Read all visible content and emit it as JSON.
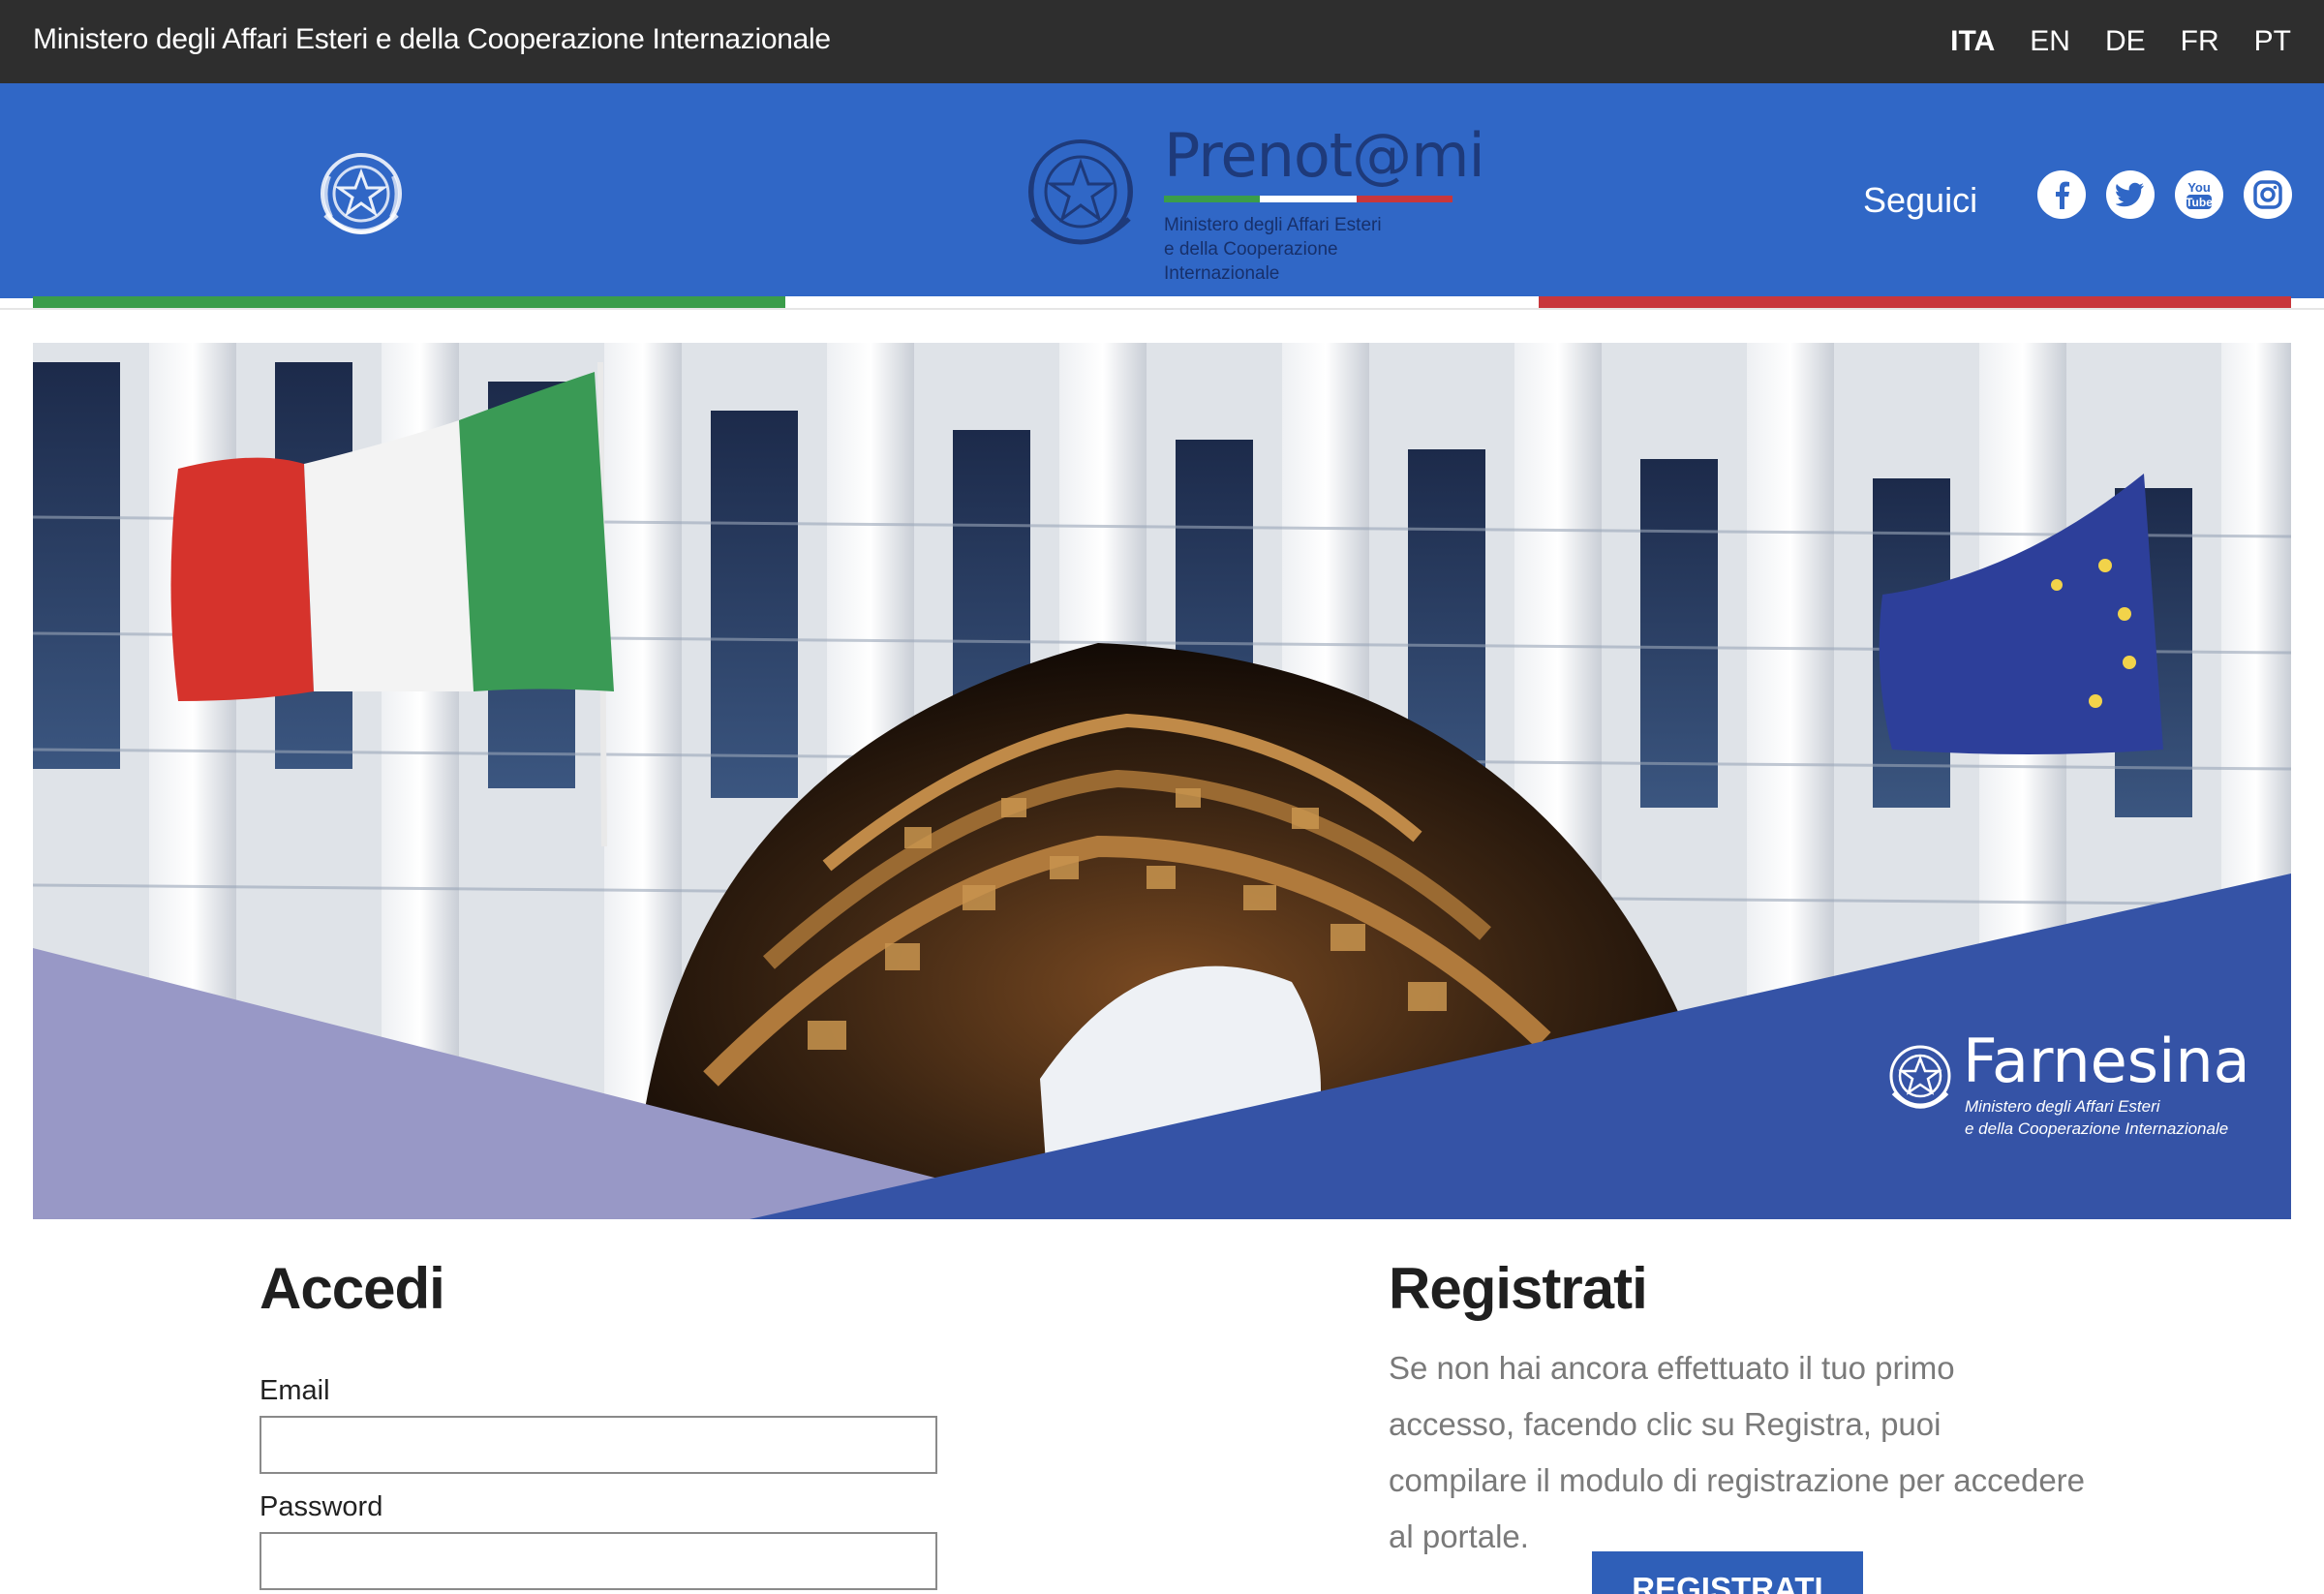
{
  "topbar": {
    "ministry_name": "Ministero degli Affari Esteri e della Cooperazione Internazionale",
    "languages": [
      "ITA",
      "EN",
      "DE",
      "FR",
      "PT"
    ],
    "active_language": "ITA"
  },
  "header": {
    "brand_name": "Prenot@mi",
    "brand_subtitle_line1": "Ministero degli Affari Esteri",
    "brand_subtitle_line2": "e della Cooperazione Internazionale",
    "follow_label": "Seguici",
    "socials": [
      "facebook-icon",
      "twitter-icon",
      "youtube-icon",
      "instagram-icon"
    ],
    "colors": {
      "topbar": "#2e2e2e",
      "header": "#3067c6",
      "flag_green": "#3a9d4a",
      "flag_white": "#ffffff",
      "flag_red": "#c8363b"
    }
  },
  "banner": {
    "logo_title": "Farnesina",
    "logo_subtitle_line1": "Ministero degli Affari Esteri",
    "logo_subtitle_line2": "e della Cooperazione Internazionale"
  },
  "login": {
    "title": "Accedi",
    "email_label": "Email",
    "email_value": "",
    "password_label": "Password",
    "password_value": ""
  },
  "register": {
    "title": "Registrati",
    "description": "Se non hai ancora effettuato il tuo primo accesso, facendo clic su Registra, puoi compilare il modulo di registrazione per accedere al portale.",
    "button_label": "REGISTRATI",
    "button_color": "#2f5fb8"
  }
}
